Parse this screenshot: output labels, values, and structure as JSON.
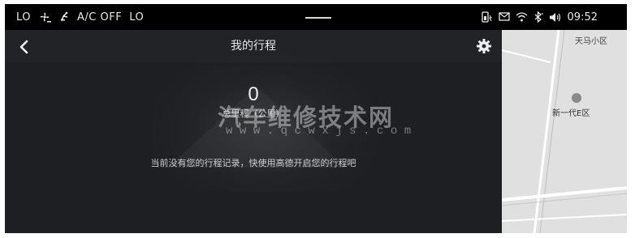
{
  "statusbar": {
    "temp_left": "LO",
    "ac_status": "A/C OFF",
    "temp_right": "LO",
    "time": "09:52",
    "icons": [
      "fan-icon",
      "seat-heat-icon",
      "phone-battery-icon",
      "message-icon",
      "wifi-icon",
      "bluetooth-icon",
      "volume-icon"
    ]
  },
  "header": {
    "title": "我的行程",
    "back_icon": "back-chevron-icon",
    "settings_icon": "gear-icon"
  },
  "summary": {
    "total_mileage_value": "0",
    "total_mileage_label": "总里程（公里）"
  },
  "watermark": {
    "cn": "汽车维修技术网",
    "en": "www.qcwxjs.com"
  },
  "empty_message": "当前没有您的行程记录，快使用高德开启您的行程吧",
  "map": {
    "label_top": "天马小区",
    "label_poi": "新一代E区",
    "poi_icon": "home-pin-icon"
  }
}
